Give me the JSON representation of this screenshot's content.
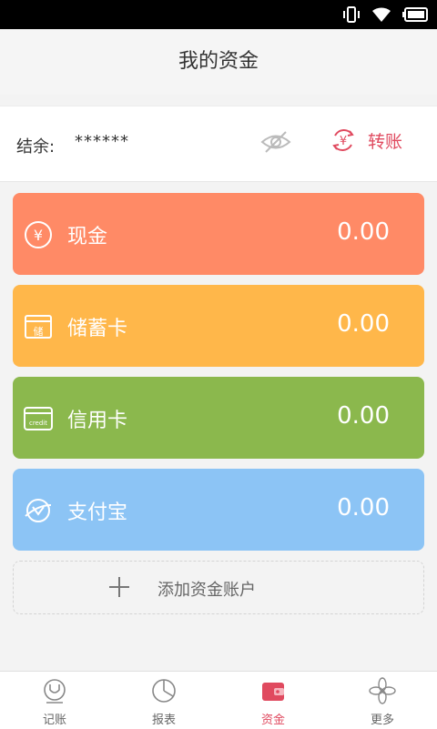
{
  "status_bar": {
    "icons": [
      "vibrate-icon",
      "wifi-icon",
      "battery-icon"
    ]
  },
  "title": "我的资金",
  "balance": {
    "label": "结余:",
    "value": "******",
    "transfer_label": "转账"
  },
  "accounts": [
    {
      "name": "现金",
      "amount": "0.00",
      "color": "#ff8a66",
      "icon": "yen-icon"
    },
    {
      "name": "储蓄卡",
      "amount": "0.00",
      "color": "#ffb74a",
      "icon": "savings-card-icon",
      "icon_text": "储"
    },
    {
      "name": "信用卡",
      "amount": "0.00",
      "color": "#8bb84d",
      "icon": "credit-card-icon",
      "icon_text": "credit"
    },
    {
      "name": "支付宝",
      "amount": "0.00",
      "color": "#8cc4f5",
      "icon": "alipay-icon"
    }
  ],
  "add_account_label": "添加资金账户",
  "tabs": [
    {
      "label": "记账",
      "icon": "bookkeeping-icon",
      "active": false
    },
    {
      "label": "报表",
      "icon": "report-chart-icon",
      "active": false
    },
    {
      "label": "资金",
      "icon": "wallet-icon",
      "active": true
    },
    {
      "label": "更多",
      "icon": "more-flower-icon",
      "active": false
    }
  ],
  "colors": {
    "accent": "#e04a5f",
    "background": "#f3f3f3"
  }
}
